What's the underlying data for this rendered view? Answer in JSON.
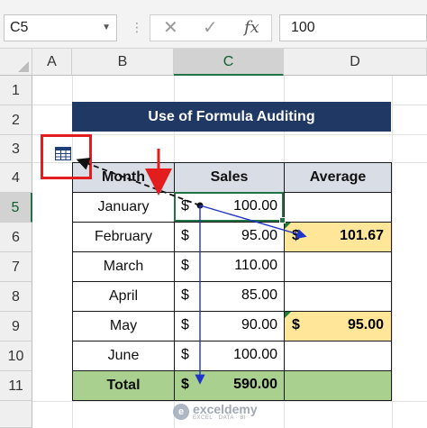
{
  "formula_bar": {
    "name_box": "C5",
    "cancel_symbol": "✕",
    "enter_symbol": "✓",
    "fx_label": "fx",
    "value": "100",
    "separator": "⋮"
  },
  "columns": [
    "A",
    "B",
    "C",
    "D"
  ],
  "selected_column": "C",
  "rows": [
    "1",
    "2",
    "3",
    "4",
    "5",
    "6",
    "7",
    "8",
    "9",
    "10",
    "11"
  ],
  "selected_row": "5",
  "title": "Use of Formula Auditing",
  "headers": {
    "month": "Month",
    "sales": "Sales",
    "average": "Average"
  },
  "data_rows": [
    {
      "month": "January",
      "currency": "$",
      "sales": "100.00"
    },
    {
      "month": "February",
      "currency": "$",
      "sales": "95.00"
    },
    {
      "month": "March",
      "currency": "$",
      "sales": "110.00"
    },
    {
      "month": "April",
      "currency": "$",
      "sales": "85.00"
    },
    {
      "month": "May",
      "currency": "$",
      "sales": "90.00"
    },
    {
      "month": "June",
      "currency": "$",
      "sales": "100.00"
    }
  ],
  "total": {
    "label": "Total",
    "currency": "$",
    "value": "590.00"
  },
  "averages": [
    {
      "row": "6",
      "currency": "$",
      "value": "101.67"
    },
    {
      "row": "9",
      "currency": "$",
      "value": "95.00"
    }
  ],
  "watermark": {
    "name": "exceldemy",
    "tagline": "EXCEL · DATA · BI"
  },
  "colors": {
    "title_bg": "#1f3864",
    "header_bg": "#d9dde5",
    "average_bg": "#ffe699",
    "total_bg": "#a9d08e",
    "highlight_red": "#e31d1d",
    "trace_arrow": "#1f35c8",
    "selection_green": "#217346"
  }
}
